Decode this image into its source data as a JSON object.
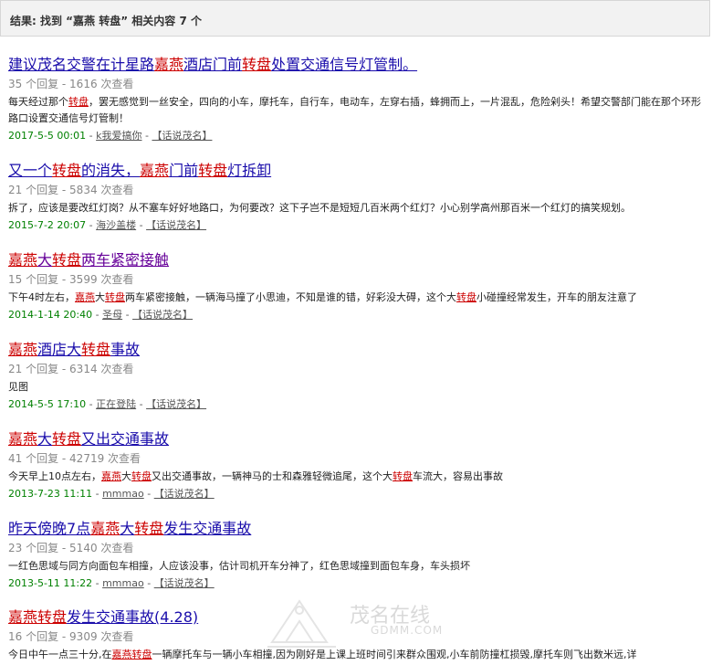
{
  "header": {
    "text": "结果: 找到 “嘉燕 转盘” 相关内容 7 个"
  },
  "results": [
    {
      "title": [
        [
          "建议茂名交警在计星路",
          0
        ],
        [
          "嘉燕",
          1
        ],
        [
          "酒店门前",
          0
        ],
        [
          "转盘",
          1
        ],
        [
          "处置交通信号灯管制。",
          0
        ]
      ],
      "title_style": "blue",
      "stats": "35 个回复 - 1616 次查看",
      "snippet": [
        [
          "每天经过那个",
          0
        ],
        [
          "转盘",
          1
        ],
        [
          "，罢无感觉到一丝安全，四向的小车，摩托车，自行车，电动车，左穿右插，蜂拥而上，一片混乱，危险剁头！希望交警部门能在那个环形路口设置交通信号灯管制！",
          0
        ]
      ],
      "date": "2017-5-5 00:01",
      "author": "k我爱搞你",
      "forum": "【话说茂名】"
    },
    {
      "title": [
        [
          "又一个",
          0
        ],
        [
          "转盘",
          1
        ],
        [
          "的消失，",
          0
        ],
        [
          "嘉燕",
          1
        ],
        [
          "门前",
          0
        ],
        [
          "转盘",
          1
        ],
        [
          "灯拆卸",
          0
        ]
      ],
      "title_style": "blue",
      "stats": "21 个回复 - 5834 次查看",
      "snippet": [
        [
          "拆了，应该是要改红灯岗？从不塞车好好地路口，为何要改？这下子岂不是短短几百米两个红灯？小心别学高州那百米一个红灯的搞笑规划。",
          0
        ]
      ],
      "date": "2015-7-2 20:07",
      "author": "海沙盖楼",
      "forum": "【话说茂名】"
    },
    {
      "title": [
        [
          "嘉燕",
          1
        ],
        [
          "大",
          0
        ],
        [
          "转盘",
          1
        ],
        [
          "两车紧密接触",
          0
        ]
      ],
      "title_style": "purple",
      "stats": "15 个回复 - 3599 次查看",
      "snippet": [
        [
          "下午4时左右，",
          0
        ],
        [
          "嘉燕",
          1
        ],
        [
          "大",
          0
        ],
        [
          "转盘",
          1
        ],
        [
          "两车紧密接触，一辆海马撞了小思迪，不知是谁的错，好彩没大碍，这个大",
          0
        ],
        [
          "转盘",
          1
        ],
        [
          "小碰撞经常发生，开车的朋友注意了",
          0
        ]
      ],
      "date": "2014-1-14 20:40",
      "author": "圣母",
      "forum": "【话说茂名】"
    },
    {
      "title": [
        [
          "嘉燕",
          1
        ],
        [
          "酒店大",
          0
        ],
        [
          "转盘",
          1
        ],
        [
          "事故",
          0
        ]
      ],
      "title_style": "blue",
      "stats": "21 个回复 - 6314 次查看",
      "snippet": [
        [
          "见图",
          0
        ]
      ],
      "date": "2014-5-5 17:10",
      "author": "正在登陆",
      "forum": "【话说茂名】"
    },
    {
      "title": [
        [
          "嘉燕",
          1
        ],
        [
          "大",
          0
        ],
        [
          "转盘",
          1
        ],
        [
          "又出交通事故",
          0
        ]
      ],
      "title_style": "blue",
      "stats": "41 个回复 - 42719 次查看",
      "snippet": [
        [
          "今天早上10点左右，",
          0
        ],
        [
          "嘉燕",
          1
        ],
        [
          "大",
          0
        ],
        [
          "转盘",
          1
        ],
        [
          "又出交通事故，一辆神马的士和森雅轻微追尾，这个大",
          0
        ],
        [
          "转盘",
          1
        ],
        [
          "车流大，容易出事故",
          0
        ]
      ],
      "date": "2013-7-23 11:11",
      "author": "mmmao",
      "forum": "【话说茂名】"
    },
    {
      "title": [
        [
          "昨天傍晚7点",
          0
        ],
        [
          "嘉燕",
          1
        ],
        [
          "大",
          0
        ],
        [
          "转盘",
          1
        ],
        [
          "发生交通事故",
          0
        ]
      ],
      "title_style": "blue",
      "stats": "23 个回复 - 5140 次查看",
      "snippet": [
        [
          "一红色思域与同方向面包车相撞，人应该没事，估计司机开车分神了，红色思域撞到面包车身，车头损坏",
          0
        ]
      ],
      "date": "2013-5-11 11:22",
      "author": "mmmao",
      "forum": "【话说茂名】"
    },
    {
      "title": [
        [
          "嘉燕",
          1
        ],
        [
          "转盘",
          1
        ],
        [
          "发生交通事故(4.28)",
          0
        ]
      ],
      "title_style": "blue",
      "stats": "16 个回复 - 9309 次查看",
      "snippet": [
        [
          "今日中午一点三十分,在",
          0
        ],
        [
          "嘉燕",
          1
        ],
        [
          "转盘",
          1
        ],
        [
          "一辆摩托车与一辆小车相撞,因为刚好是上课上班时间引来群众围观,小车前防撞杠损毁,摩托车则飞出数米远,详",
          0
        ]
      ],
      "date": "",
      "author": "",
      "forum": ""
    }
  ],
  "watermark": {
    "text": "茂名在线",
    "sub": "GDMM.COM"
  }
}
